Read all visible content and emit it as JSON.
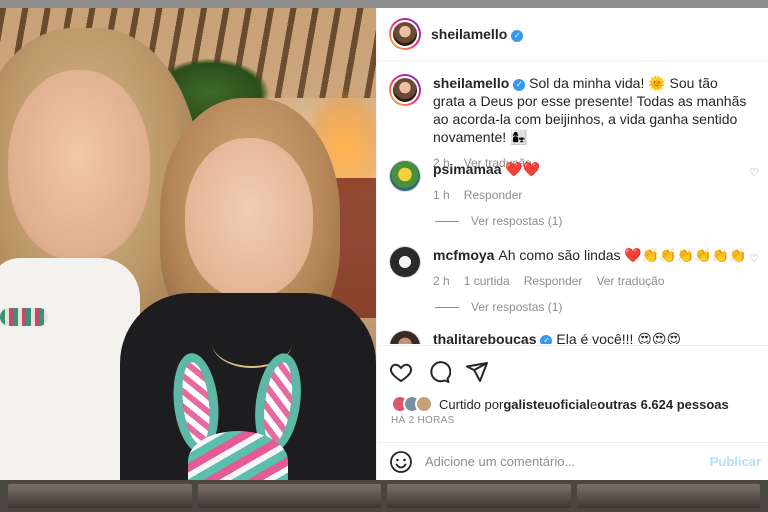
{
  "post": {
    "author": "sheilamello",
    "verified_mark": "✓"
  },
  "caption": {
    "author": "sheilamello",
    "text": " Sol da minha vida! 🌞 Sou tão grata a Deus por esse presente! Todas as manhãs ao acorda-la com beijinhos, a vida ganha sentido novamente! 👩‍👧",
    "time": "2 h",
    "translate": "Ver tradução"
  },
  "comments": [
    {
      "author": "psimamaa",
      "text": "❤️❤️",
      "time": "1 h",
      "reply": "Responder",
      "view_replies": "Ver respostas (1)"
    },
    {
      "author": "mcfmoya",
      "text": "Ah como são lindas ❤️👏👏👏👏👏👏",
      "time": "2 h",
      "likes": "1 curtida",
      "reply": "Responder",
      "translate": "Ver tradução",
      "view_replies": "Ver respostas (1)"
    },
    {
      "author": "thalitareboucas",
      "text": "Ela é você!!! 😍😍😍"
    }
  ],
  "likes": {
    "prefix": "Curtido por ",
    "user": "galisteuoficial",
    "middle": " e ",
    "others": "outras 6.624 pessoas"
  },
  "post_time": "HÁ 2 HORAS",
  "add_comment": {
    "placeholder": "Adicione um comentário...",
    "publish": "Publicar"
  },
  "icons": [
    "heart-icon",
    "comment-icon",
    "share-icon",
    "smiley-icon",
    "verified-icon"
  ],
  "colors": {
    "accent": "#3897f0",
    "publish_disabled": "#b2dffc",
    "text": "#262626",
    "muted": "#8e8e8e"
  }
}
